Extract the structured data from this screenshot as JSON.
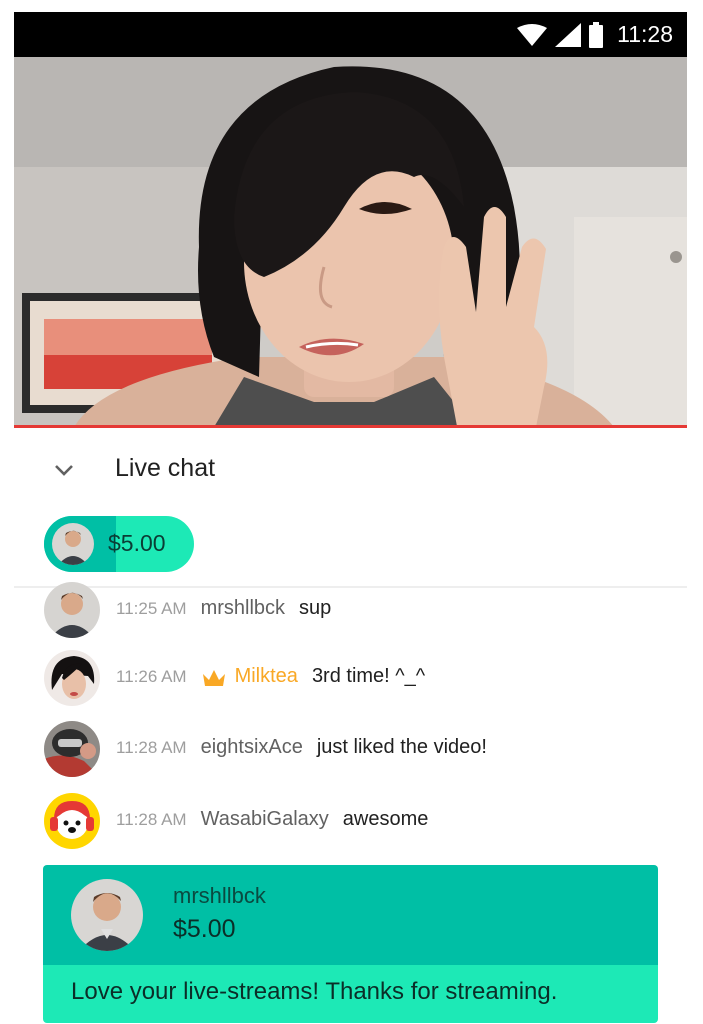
{
  "status_bar": {
    "time": "11:28",
    "icons": [
      "wifi-icon",
      "signal-icon",
      "battery-icon"
    ]
  },
  "video": {
    "description_icon": "live-stream-video"
  },
  "chat": {
    "title": "Live chat",
    "pinned_super_chat": {
      "amount": "$5.00"
    },
    "messages": [
      {
        "time": "11:25 AM",
        "author": "mrshllbck",
        "text": "sup",
        "owner": false
      },
      {
        "time": "11:26 AM",
        "author": "Milktea",
        "text": "3rd time! ^_^",
        "owner": true
      },
      {
        "time": "11:28 AM",
        "author": "eightsixAce",
        "text": "just liked the video!",
        "owner": false
      },
      {
        "time": "11:28 AM",
        "author": "WasabiGalaxy",
        "text": "awesome",
        "owner": false
      }
    ],
    "super_chat_card": {
      "author": "mrshllbck",
      "amount": "$5.00",
      "message": "Love your live-streams! Thanks for streaming."
    }
  },
  "colors": {
    "accent_dark": "#00bfa5",
    "accent_light": "#1de9b6",
    "owner": "#f9a825",
    "progress": "#e53935"
  }
}
